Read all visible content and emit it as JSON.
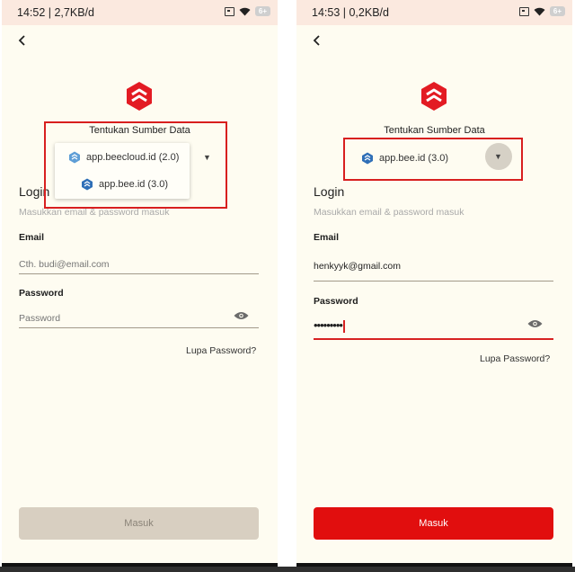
{
  "left": {
    "status": {
      "time": "14:52 | 2,7KB/d",
      "battery": "6+"
    },
    "source_title": "Tentukan Sumber Data",
    "dropdown_options": [
      "app.beecloud.id (2.0)",
      "app.bee.id (3.0)"
    ],
    "login_title": "Login",
    "login_subtitle": "Masukkan email & password masuk",
    "email_label": "Email",
    "email_placeholder": "Cth. budi@email.com",
    "password_label": "Password",
    "password_placeholder": "Password",
    "forgot": "Lupa Password?",
    "submit": "Masuk"
  },
  "right": {
    "status": {
      "time": "14:53 | 0,2KB/d",
      "battery": "6+"
    },
    "source_title": "Tentukan Sumber Data",
    "selected_source": "app.bee.id (3.0)",
    "login_title": "Login",
    "login_subtitle": "Masukkan email & password masuk",
    "email_label": "Email",
    "email_value": "henkyyk@gmail.com",
    "password_label": "Password",
    "password_value": "•••••••••",
    "forgot": "Lupa Password?",
    "submit": "Masuk"
  },
  "colors": {
    "brand_red": "#e31b23",
    "app_background": "#fefcf1",
    "disabled_button": "#d8cfc1",
    "active_button": "#e10e0e",
    "highlight_box": "#d81f1f"
  }
}
